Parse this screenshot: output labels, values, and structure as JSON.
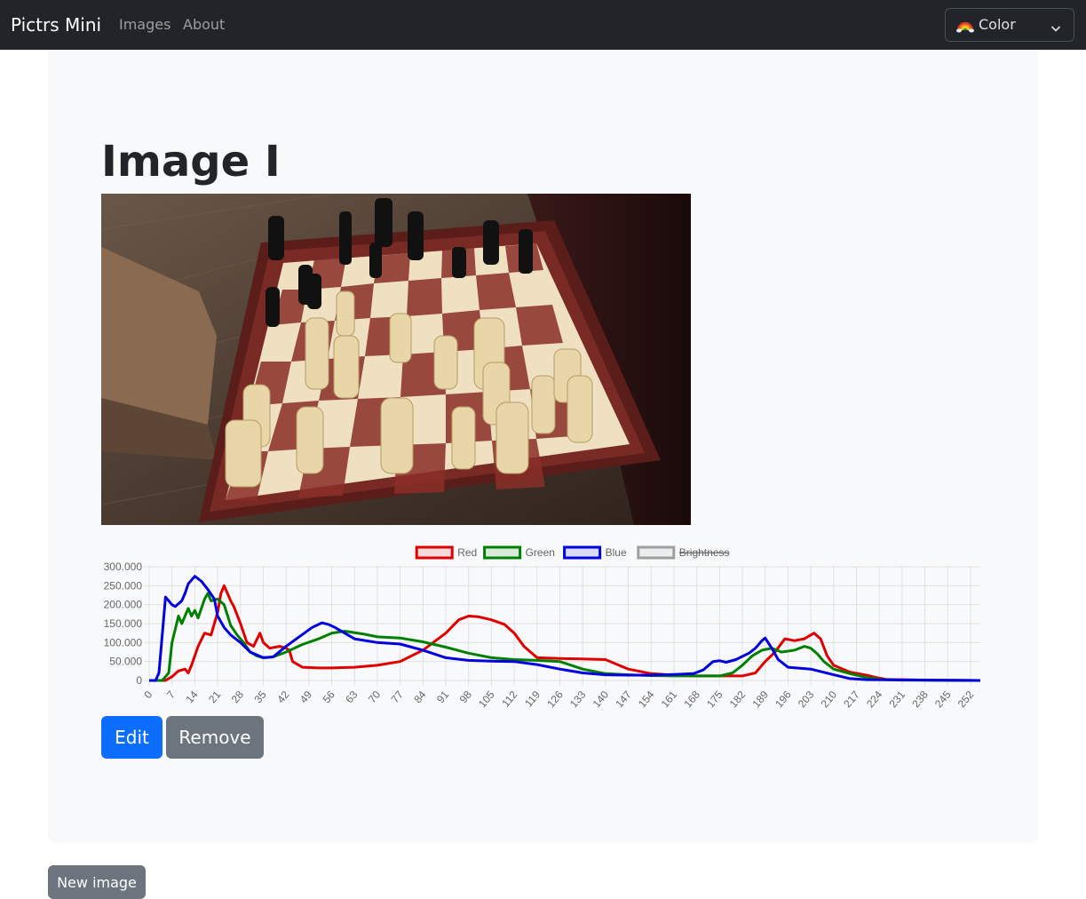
{
  "navbar": {
    "brand": "Pictrs Mini",
    "links": [
      "Images",
      "About"
    ],
    "theme_select": {
      "value": "Color",
      "icon": "rainbow-icon"
    }
  },
  "page": {
    "title": "Image I",
    "image_alt": "Chessboard with black and white chess pieces on a wooden table"
  },
  "buttons": {
    "edit": "Edit",
    "remove": "Remove",
    "new_image": "New image"
  },
  "colors": {
    "navbar_bg": "#212529",
    "primary": "#0d6efd",
    "secondary": "#6c757d",
    "red": "#e00000",
    "green": "#008000",
    "blue": "#0000e0",
    "brightness": "#9e9e9e"
  },
  "chart_data": {
    "type": "line",
    "legend": [
      {
        "name": "Red",
        "color": "#e00000",
        "hidden": false
      },
      {
        "name": "Green",
        "color": "#008000",
        "hidden": false
      },
      {
        "name": "Blue",
        "color": "#0000e0",
        "hidden": false
      },
      {
        "name": "Brightness",
        "color": "#9e9e9e",
        "hidden": true
      }
    ],
    "legend_position": "top",
    "ylim": [
      0,
      300000
    ],
    "y_ticks": [
      "0",
      "50.000",
      "100.000",
      "150.000",
      "200.000",
      "250.000",
      "300.000"
    ],
    "xlim": [
      0,
      255
    ],
    "x_ticks": [
      "0",
      "7",
      "14",
      "21",
      "28",
      "35",
      "42",
      "49",
      "56",
      "63",
      "70",
      "77",
      "84",
      "91",
      "98",
      "105",
      "112",
      "119",
      "126",
      "133",
      "140",
      "147",
      "154",
      "161",
      "168",
      "175",
      "182",
      "189",
      "196",
      "203",
      "210",
      "217",
      "224",
      "231",
      "238",
      "245",
      "252"
    ],
    "grid": true,
    "series": [
      {
        "name": "Red",
        "points": [
          [
            0,
            0
          ],
          [
            5,
            0
          ],
          [
            7,
            10000
          ],
          [
            9,
            25000
          ],
          [
            11,
            30000
          ],
          [
            12,
            20000
          ],
          [
            13,
            40000
          ],
          [
            15,
            90000
          ],
          [
            17,
            125000
          ],
          [
            19,
            120000
          ],
          [
            21,
            180000
          ],
          [
            22,
            230000
          ],
          [
            23,
            250000
          ],
          [
            25,
            210000
          ],
          [
            26,
            195000
          ],
          [
            28,
            150000
          ],
          [
            30,
            100000
          ],
          [
            32,
            90000
          ],
          [
            34,
            125000
          ],
          [
            35,
            100000
          ],
          [
            37,
            85000
          ],
          [
            40,
            90000
          ],
          [
            42,
            85000
          ],
          [
            43,
            80000
          ],
          [
            44,
            50000
          ],
          [
            47,
            35000
          ],
          [
            52,
            33000
          ],
          [
            56,
            33000
          ],
          [
            63,
            35000
          ],
          [
            70,
            40000
          ],
          [
            77,
            50000
          ],
          [
            84,
            80000
          ],
          [
            91,
            125000
          ],
          [
            95,
            160000
          ],
          [
            98,
            170000
          ],
          [
            101,
            168000
          ],
          [
            105,
            160000
          ],
          [
            109,
            148000
          ],
          [
            112,
            125000
          ],
          [
            115,
            90000
          ],
          [
            119,
            60000
          ],
          [
            126,
            58000
          ],
          [
            133,
            57000
          ],
          [
            140,
            55000
          ],
          [
            147,
            30000
          ],
          [
            154,
            18000
          ],
          [
            161,
            14000
          ],
          [
            168,
            12000
          ],
          [
            175,
            12000
          ],
          [
            182,
            12000
          ],
          [
            186,
            20000
          ],
          [
            189,
            50000
          ],
          [
            192,
            75000
          ],
          [
            195,
            110000
          ],
          [
            198,
            105000
          ],
          [
            201,
            110000
          ],
          [
            204,
            125000
          ],
          [
            206,
            110000
          ],
          [
            208,
            65000
          ],
          [
            210,
            40000
          ],
          [
            215,
            22000
          ],
          [
            220,
            14000
          ],
          [
            223,
            8000
          ],
          [
            226,
            3000
          ],
          [
            230,
            2000
          ],
          [
            240,
            1000
          ],
          [
            255,
            0
          ]
        ]
      },
      {
        "name": "Green",
        "points": [
          [
            0,
            0
          ],
          [
            4,
            0
          ],
          [
            6,
            20000
          ],
          [
            7,
            100000
          ],
          [
            9,
            170000
          ],
          [
            10,
            150000
          ],
          [
            12,
            190000
          ],
          [
            13,
            170000
          ],
          [
            14,
            185000
          ],
          [
            15,
            165000
          ],
          [
            17,
            215000
          ],
          [
            18,
            230000
          ],
          [
            19,
            210000
          ],
          [
            21,
            215000
          ],
          [
            23,
            200000
          ],
          [
            25,
            145000
          ],
          [
            27,
            120000
          ],
          [
            29,
            100000
          ],
          [
            31,
            75000
          ],
          [
            33,
            65000
          ],
          [
            35,
            60000
          ],
          [
            38,
            62000
          ],
          [
            42,
            75000
          ],
          [
            47,
            95000
          ],
          [
            52,
            110000
          ],
          [
            56,
            125000
          ],
          [
            60,
            130000
          ],
          [
            66,
            122000
          ],
          [
            70,
            115000
          ],
          [
            77,
            112000
          ],
          [
            84,
            102000
          ],
          [
            91,
            88000
          ],
          [
            98,
            72000
          ],
          [
            105,
            60000
          ],
          [
            112,
            55000
          ],
          [
            119,
            53000
          ],
          [
            126,
            50000
          ],
          [
            133,
            30000
          ],
          [
            140,
            18000
          ],
          [
            147,
            15000
          ],
          [
            154,
            13000
          ],
          [
            161,
            12000
          ],
          [
            168,
            12000
          ],
          [
            175,
            12000
          ],
          [
            179,
            20000
          ],
          [
            182,
            40000
          ],
          [
            185,
            65000
          ],
          [
            188,
            80000
          ],
          [
            191,
            85000
          ],
          [
            194,
            75000
          ],
          [
            198,
            80000
          ],
          [
            201,
            90000
          ],
          [
            203,
            85000
          ],
          [
            205,
            70000
          ],
          [
            207,
            50000
          ],
          [
            210,
            30000
          ],
          [
            215,
            18000
          ],
          [
            220,
            8000
          ],
          [
            224,
            3000
          ],
          [
            230,
            1000
          ],
          [
            255,
            0
          ]
        ]
      },
      {
        "name": "Blue",
        "points": [
          [
            0,
            0
          ],
          [
            2,
            0
          ],
          [
            3,
            20000
          ],
          [
            5,
            220000
          ],
          [
            7,
            200000
          ],
          [
            8,
            195000
          ],
          [
            10,
            210000
          ],
          [
            11,
            230000
          ],
          [
            12,
            255000
          ],
          [
            14,
            275000
          ],
          [
            16,
            262000
          ],
          [
            18,
            240000
          ],
          [
            20,
            215000
          ],
          [
            21,
            170000
          ],
          [
            23,
            140000
          ],
          [
            25,
            120000
          ],
          [
            28,
            100000
          ],
          [
            31,
            75000
          ],
          [
            35,
            60000
          ],
          [
            38,
            62000
          ],
          [
            42,
            90000
          ],
          [
            46,
            115000
          ],
          [
            50,
            140000
          ],
          [
            53,
            152000
          ],
          [
            55,
            148000
          ],
          [
            57,
            140000
          ],
          [
            60,
            125000
          ],
          [
            63,
            110000
          ],
          [
            70,
            100000
          ],
          [
            77,
            96000
          ],
          [
            84,
            80000
          ],
          [
            91,
            60000
          ],
          [
            98,
            53000
          ],
          [
            105,
            51000
          ],
          [
            112,
            50000
          ],
          [
            119,
            42000
          ],
          [
            126,
            30000
          ],
          [
            133,
            20000
          ],
          [
            140,
            15000
          ],
          [
            147,
            14000
          ],
          [
            154,
            14000
          ],
          [
            161,
            16000
          ],
          [
            167,
            18000
          ],
          [
            170,
            28000
          ],
          [
            173,
            50000
          ],
          [
            175,
            52000
          ],
          [
            177,
            48000
          ],
          [
            180,
            55000
          ],
          [
            184,
            72000
          ],
          [
            186,
            85000
          ],
          [
            188,
            105000
          ],
          [
            189,
            112000
          ],
          [
            191,
            85000
          ],
          [
            193,
            55000
          ],
          [
            196,
            35000
          ],
          [
            203,
            30000
          ],
          [
            210,
            15000
          ],
          [
            215,
            5000
          ],
          [
            220,
            2000
          ],
          [
            255,
            0
          ]
        ]
      }
    ]
  }
}
